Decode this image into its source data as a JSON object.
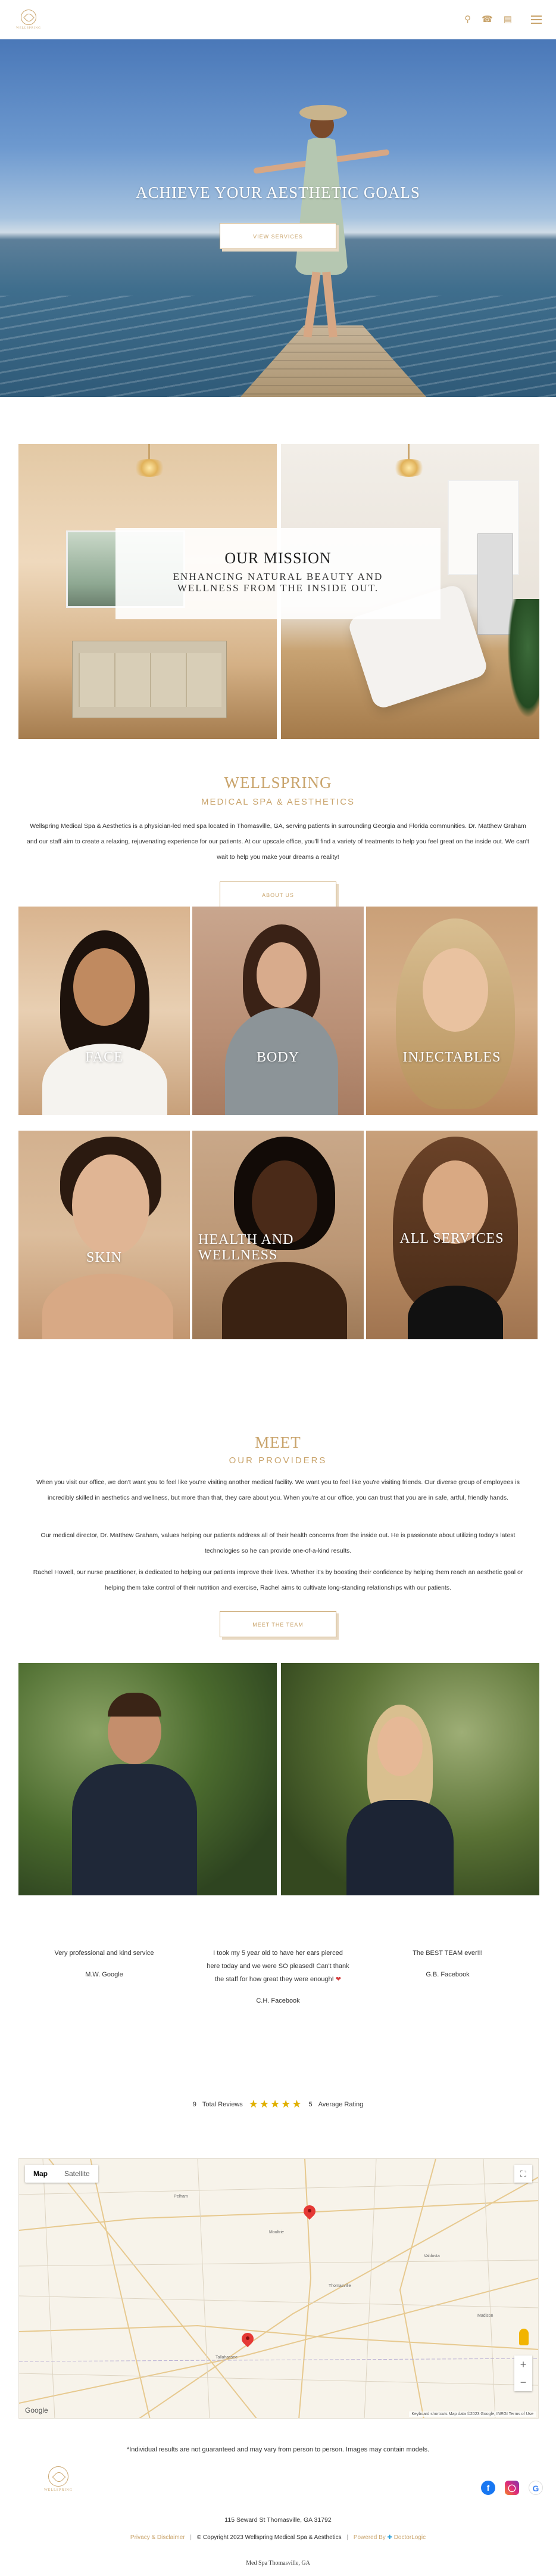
{
  "header": {
    "logo_text": "WELLSPRING",
    "icons": [
      "map-pin-icon",
      "phone-icon",
      "calendar-icon",
      "menu-icon"
    ]
  },
  "hero": {
    "title": "ACHIEVE YOUR AESTHETIC GOALS",
    "button": "VIEW SERVICES"
  },
  "mission": {
    "title": "OUR MISSION",
    "subtitle": "ENHANCING NATURAL BEAUTY AND WELLNESS FROM THE INSIDE OUT."
  },
  "about": {
    "title": "WELLSPRING",
    "subtitle": "MEDICAL SPA & AESTHETICS",
    "text": "Wellspring Medical Spa & Aesthetics is a physician-led med spa located in Thomasville, GA, serving patients in surrounding Georgia and Florida communities. Dr. Matthew Graham and our staff aim to create a relaxing, rejuvenating experience for our patients. At our upscale office, you'll find a variety of treatments to help you feel great on the inside out. We can't wait to help you make your dreams a reality!",
    "button": "ABOUT US"
  },
  "services": [
    {
      "label": "FACE"
    },
    {
      "label": "BODY"
    },
    {
      "label": "INJECTABLES"
    },
    {
      "label": "SKIN"
    },
    {
      "label": "HEALTH AND WELLNESS"
    },
    {
      "label": "ALL SERVICES"
    }
  ],
  "providers": {
    "title": "MEET",
    "subtitle": "OUR PROVIDERS",
    "p1": "When you visit our office, we don't want you to feel like you're visiting another medical facility. We want you to feel like you're visiting friends. Our diverse group of employees is incredibly skilled in aesthetics and wellness, but more than that, they care about you. When you're at our office, you can trust that you are in safe, artful, friendly hands.",
    "p2": "Our medical director, Dr. Matthew Graham, values helping our patients address all of their health concerns from the inside out. He is passionate about utilizing today's latest technologies so he can provide one-of-a-kind results.",
    "p3": "Rachel Howell, our nurse practitioner, is dedicated to helping our patients improve their lives. Whether it's by boosting their confidence by helping them reach an aesthetic goal or helping them take control of their nutrition and exercise, Rachel aims to cultivate long-standing relationships with our patients.",
    "button": "MEET THE TEAM"
  },
  "reviews": [
    {
      "text": "Very professional and kind service",
      "author": "M.W. Google"
    },
    {
      "text": "I took my 5 year old to have her ears pierced here today and we were SO pleased! Can't thank the staff for how great they were enough!",
      "author": "C.H. Facebook"
    },
    {
      "text": "The BEST TEAM ever!!!",
      "author": "G.B. Facebook"
    }
  ],
  "ratings": {
    "total_count": "9",
    "total_label": "Total Reviews",
    "stars": "★★★★★",
    "average": "5",
    "average_label": "Average Rating"
  },
  "map": {
    "tab_map": "Map",
    "tab_satellite": "Satellite",
    "attribution": "Keyboard shortcuts   Map data ©2023 Google, INEGI   Terms of Use",
    "google": "Google"
  },
  "footer": {
    "disclaimer": "*Individual results are not guaranteed and may vary from person to person. Images may contain models.",
    "address": "115 Seward St   Thomasville, GA 31792",
    "privacy": "Privacy & Disclaimer",
    "copyright": "© Copyright 2023 Wellspring Medical Spa & Aesthetics",
    "powered": "Powered By",
    "powered_brand": "DoctorLogic",
    "tagline": "Med Spa Thomasville, GA"
  },
  "colors": {
    "accent": "#c9a46c",
    "text": "#333333"
  }
}
